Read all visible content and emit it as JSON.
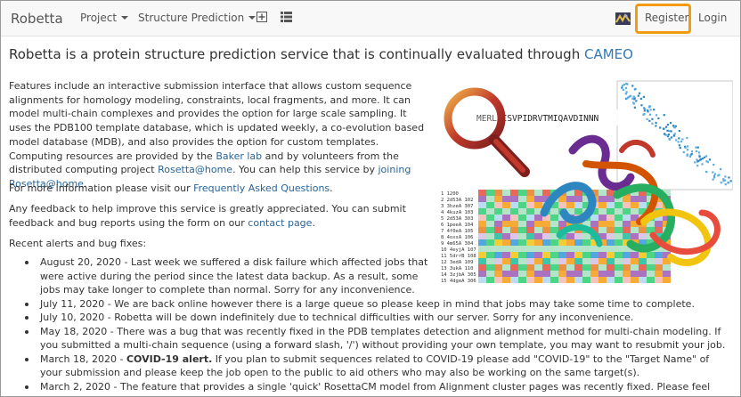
{
  "navbar": {
    "brand": "Robetta",
    "project_label": "Project",
    "structure_label": "Structure Prediction",
    "register_label": "Register",
    "login_label": "Login"
  },
  "headline": {
    "text": "Robetta is a protein structure prediction service that is continually evaluated through ",
    "link": "CAMEO"
  },
  "intro": {
    "p1": "Features include an interactive submission interface that allows custom sequence alignments for homology modeling, constraints, local fragments, and more. It can model multi-chain complexes and provides the option for large scale sampling. It uses the PDB100 template database, which is updated weekly, a co-evolution based model database (MDB), and also provides the option for custom templates. Computing resources are provided by the ",
    "baker_link": "Baker lab",
    "p1b": " and by volunteers from the distributed computing project ",
    "rosetta_link": "Rosetta@home",
    "p1c": ". You can help this service by ",
    "join_link": "joining Rosetta@home",
    "p1d": ".",
    "p2": "For more information please visit our ",
    "faq_link": "Frequently Asked Questions",
    "p2b": ".",
    "p3": "Any feedback to help improve this service is greatly appreciated. You can submit feedback and bug reports using the form on our ",
    "contact_link": "contact page",
    "p3b": ".",
    "p4": "Recent alerts and bug fixes:"
  },
  "alerts": [
    {
      "date": "August 20, 2020",
      "bold": "",
      "text": " - Last week we suffered a disk failure which affected jobs that were active during the period since the latest data backup. As a result, some jobs may take longer to complete than normal. Sorry for any inconvenience."
    },
    {
      "date": "July 11, 2020",
      "bold": "",
      "text": " - We are back online however there is a large queue so please keep in mind that jobs may take some time to complete."
    },
    {
      "date": "July 10, 2020",
      "bold": "",
      "text": " - Robetta will be down indefinitely due to technical difficulties with our server. Sorry for any inconvenience."
    },
    {
      "date": "May 18, 2020",
      "bold": "",
      "text": " - There was a bug that was recently fixed in the PDB templates detection and alignment method for multi-chain modeling. If you submitted a multi-chain sequence (using a forward slash, '/') without providing your own template, you may want to resubmit your job."
    },
    {
      "date": "March 18, 2020",
      "bold": "COVID-19 alert.",
      "text": " If you plan to submit sequences related to COVID-19 please add \"COVID-19\" to the \"Target Name\" of your submission and please keep the job open to the public to aid others who may also be working on the same target(s)."
    },
    {
      "date": "March 2, 2020",
      "bold": "",
      "text": " - The feature that provides a single 'quick' RosettaCM model from Alignment cluster pages was recently fixed. Please feel free to"
    }
  ],
  "hero": {
    "sequence": "MERLDISVPIDRVTMIQAVDINNN",
    "alignment_rows": [
      "1 1200",
      "2 2d53A 102",
      "3 3hzeA 307",
      "4 4kuzA 103",
      "5 2d53A 303",
      "6 1peeA 104",
      "7 4f0eA 105",
      "8 4oxsA 106",
      "9 4m65A 304",
      "10 4eyjA 107",
      "11 5drrB 108",
      "12 3edA 109",
      "13 3ukA 110",
      "14 3zjbA 305",
      "15 4dgeA 306"
    ]
  },
  "colors": {
    "accent": "#337ab7",
    "highlight": "#f39c12",
    "navbar_bg": "#f8f8f8"
  }
}
